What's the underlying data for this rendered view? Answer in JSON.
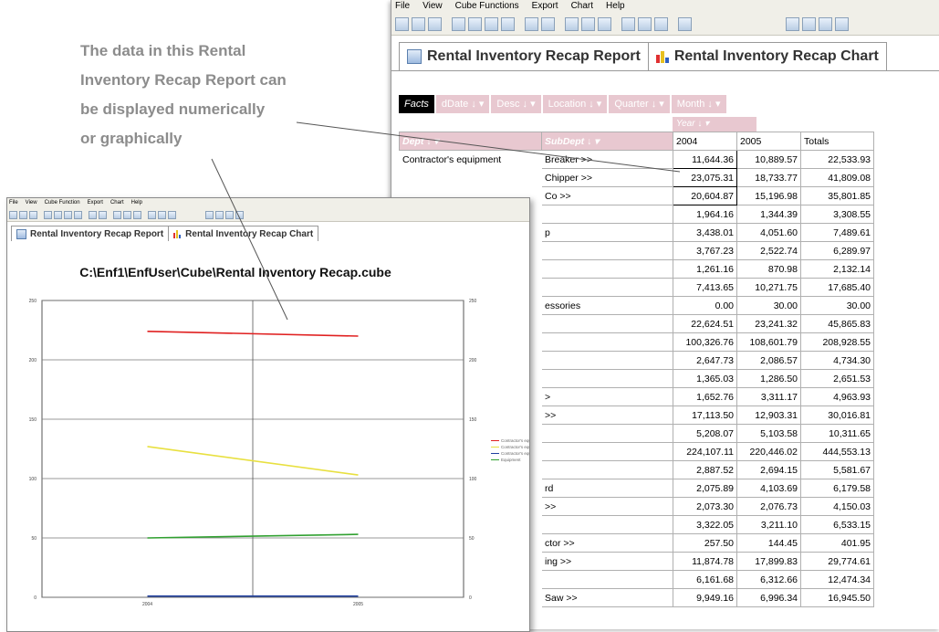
{
  "caption": {
    "lines": [
      "The data in this Rental",
      "Inventory Recap Report can",
      "be displayed numerically",
      "or graphically"
    ]
  },
  "report_window": {
    "menu": [
      "File",
      "View",
      "Cube Functions",
      "Export",
      "Chart",
      "Help"
    ],
    "tabs": [
      {
        "label": "Rental Inventory Recap Report"
      },
      {
        "label": "Rental Inventory Recap Chart"
      }
    ],
    "filters": {
      "facts": "Facts",
      "chips": [
        "dDate ↓ ▾",
        "Desc ↓ ▾",
        "Location ↓ ▾",
        "Quarter ↓ ▾",
        "Month ↓ ▾"
      ]
    },
    "year_header": "Year ↓ ▾",
    "columns": {
      "dept": "Dept  ↓ ▾",
      "subdept": "SubDept  ↓ ▾",
      "y2004": "2004",
      "y2005": "2005",
      "totals": "Totals"
    },
    "dept_label": "Contractor's equipment",
    "rows": [
      {
        "sub": "Breaker >>",
        "a": "11,644.36",
        "b": "10,889.57",
        "t": "22,533.93"
      },
      {
        "sub": "Chipper >>",
        "a": "23,075.31",
        "b": "18,733.77",
        "t": "41,809.08"
      },
      {
        "sub": "Co         >>",
        "a": "20,604.87",
        "b": "15,196.98",
        "t": "35,801.85"
      },
      {
        "sub": "",
        "a": "1,964.16",
        "b": "1,344.39",
        "t": "3,308.55"
      },
      {
        "sub": "          p",
        "a": "3,438.01",
        "b": "4,051.60",
        "t": "7,489.61"
      },
      {
        "sub": "",
        "a": "3,767.23",
        "b": "2,522.74",
        "t": "6,289.97"
      },
      {
        "sub": "",
        "a": "1,261.16",
        "b": "870.98",
        "t": "2,132.14"
      },
      {
        "sub": "",
        "a": "7,413.65",
        "b": "10,271.75",
        "t": "17,685.40"
      },
      {
        "sub": "            essories",
        "a": "0.00",
        "b": "30.00",
        "t": "30.00"
      },
      {
        "sub": "",
        "a": "22,624.51",
        "b": "23,241.32",
        "t": "45,865.83"
      },
      {
        "sub": "",
        "a": "100,326.76",
        "b": "108,601.79",
        "t": "208,928.55"
      },
      {
        "sub": "",
        "a": "2,647.73",
        "b": "2,086.57",
        "t": "4,734.30"
      },
      {
        "sub": "",
        "a": "1,365.03",
        "b": "1,286.50",
        "t": "2,651.53"
      },
      {
        "sub": "          >",
        "a": "1,652.76",
        "b": "3,311.17",
        "t": "4,963.93"
      },
      {
        "sub": "          >>",
        "a": "17,113.50",
        "b": "12,903.31",
        "t": "30,016.81"
      },
      {
        "sub": "",
        "a": "5,208.07",
        "b": "5,103.58",
        "t": "10,311.65"
      },
      {
        "sub": "",
        "a": "224,107.11",
        "b": "220,446.02",
        "t": "444,553.13"
      },
      {
        "sub": "",
        "a": "2,887.52",
        "b": "2,694.15",
        "t": "5,581.67"
      },
      {
        "sub": "          rd",
        "a": "2,075.89",
        "b": "4,103.69",
        "t": "6,179.58"
      },
      {
        "sub": "          >>",
        "a": "2,073.30",
        "b": "2,076.73",
        "t": "4,150.03"
      },
      {
        "sub": "",
        "a": "3,322.05",
        "b": "3,211.10",
        "t": "6,533.15"
      },
      {
        "sub": "          ctor >>",
        "a": "257.50",
        "b": "144.45",
        "t": "401.95"
      },
      {
        "sub": "          ing >>",
        "a": "11,874.78",
        "b": "17,899.83",
        "t": "29,774.61"
      },
      {
        "sub": "",
        "a": "6,161.68",
        "b": "6,312.66",
        "t": "12,474.34"
      },
      {
        "sub": "Saw >>",
        "a": "9,949.16",
        "b": "6,996.34",
        "t": "16,945.50"
      }
    ]
  },
  "chart_window": {
    "menu": [
      "File",
      "View",
      "Cube Function",
      "Export",
      "Chart",
      "Help"
    ],
    "tabs": [
      {
        "label": "Rental Inventory Recap Report"
      },
      {
        "label": "Rental Inventory Recap Chart"
      }
    ]
  },
  "colors": {
    "pink_header": "#e8c8d0",
    "series_red": "#e02020",
    "series_yellow": "#e8e040",
    "series_blue": "#2040a0",
    "series_green": "#30a030"
  },
  "chart_data": {
    "type": "line",
    "title": "C:\\Enf1\\EnfUser\\Cube\\Rental Inventory Recap.cube",
    "x": [
      "2004",
      "2005"
    ],
    "ylim": [
      0,
      250
    ],
    "yticks": [
      "0",
      "50",
      "100",
      "150",
      "200",
      "250"
    ],
    "grid": true,
    "legend_position": "right",
    "series": [
      {
        "name": "Contractor's equipment",
        "color": "#e02020",
        "values": [
          224,
          220
        ]
      },
      {
        "name": "Contractor's equipment-021",
        "color": "#e8e040",
        "values": [
          127,
          103
        ]
      },
      {
        "name": "Contractor's equipment-039",
        "color": "#2040a0",
        "values": [
          1,
          1
        ]
      },
      {
        "name": "Equipment",
        "color": "#30a030",
        "values": [
          50,
          53
        ]
      }
    ]
  }
}
